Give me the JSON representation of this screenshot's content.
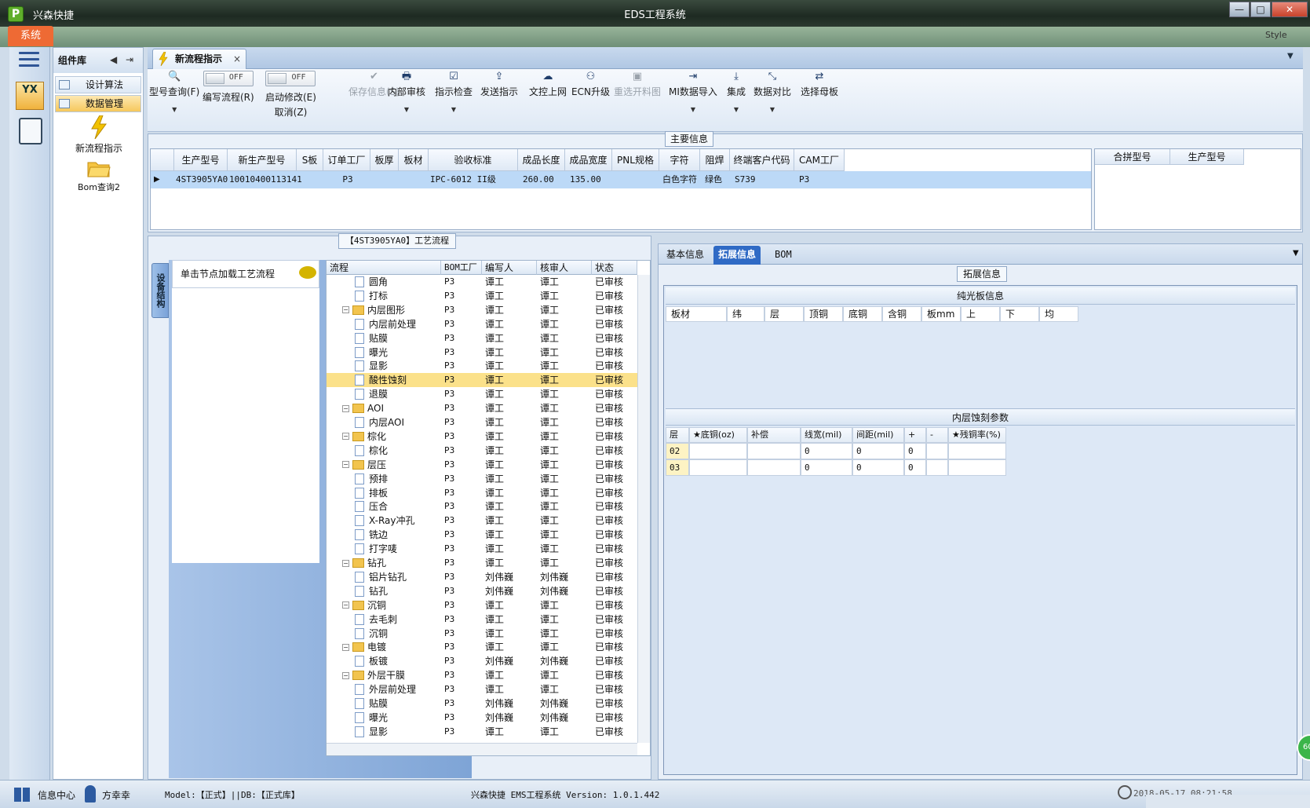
{
  "app": {
    "name": "兴森快捷",
    "window_title": "EDS工程系统",
    "icon_letter": "P"
  },
  "window_buttons": {
    "minimize": "—",
    "restore": "□",
    "close": "✕"
  },
  "menu": {
    "system": "系统",
    "style": "Style"
  },
  "component_panel": {
    "title": "组件库",
    "items": [
      {
        "label": "设计算法"
      },
      {
        "label": "数据管理"
      }
    ],
    "tiles": [
      {
        "label": "新流程指示"
      },
      {
        "label": "Bom查询2"
      }
    ]
  },
  "left_strip": {
    "logo_text": "YX"
  },
  "tab": {
    "label": "新流程指示",
    "close": "×"
  },
  "toolbar": {
    "model_query": "型号查询(F)",
    "write_flow": "编写流程(R)",
    "start_modify": "启动修改(E)",
    "cancel": "取消(Z)",
    "toggle_off": "OFF",
    "save_info": "保存信息(S)",
    "internal_review": "内部审核",
    "instruction_check": "指示检查",
    "send_instruction": "发送指示",
    "doc_upload": "文控上网",
    "ecn_upgrade": "ECN升级",
    "reselect_layout": "重选开料图",
    "mi_import": "MI数据导入",
    "integrate": "集成",
    "data_compare": "数据对比",
    "select_master": "选择母板"
  },
  "main_info": {
    "title": "主要信息",
    "columns": [
      "生产型号",
      "新生产型号",
      "S板",
      "订单工厂",
      "板厚",
      "板材",
      "验收标准",
      "成品长度",
      "成品宽度",
      "PNL规格",
      "字符",
      "阻焊",
      "终端客户代码",
      "CAM工厂"
    ],
    "row": [
      "4ST3905YA0",
      "10010400113141",
      "",
      "P3",
      "",
      "",
      "IPC-6012 II级",
      "260.00",
      "135.00",
      "",
      "白色字符",
      "绿色",
      "S739",
      "P3"
    ],
    "side_columns": [
      "合拼型号",
      "生产型号"
    ]
  },
  "process": {
    "title": "【4ST3905YA0】工艺流程",
    "vertical_tab": "设备结构",
    "load_hint": "单击节点加载工艺流程",
    "columns": [
      "流程",
      "BOM工厂",
      "编写人",
      "核审人",
      "状态"
    ],
    "rows": [
      {
        "name": "圆角",
        "level": 2,
        "type": "file",
        "factory": "P3",
        "writer": "谭工",
        "reviewer": "谭工",
        "status": "已审核"
      },
      {
        "name": "打标",
        "level": 2,
        "type": "file",
        "factory": "P3",
        "writer": "谭工",
        "reviewer": "谭工",
        "status": "已审核"
      },
      {
        "name": "内层图形",
        "level": 1,
        "type": "folder",
        "factory": "P3",
        "writer": "谭工",
        "reviewer": "谭工",
        "status": "已审核"
      },
      {
        "name": "内层前处理",
        "level": 2,
        "type": "file",
        "factory": "P3",
        "writer": "谭工",
        "reviewer": "谭工",
        "status": "已审核"
      },
      {
        "name": "贴膜",
        "level": 2,
        "type": "file",
        "factory": "P3",
        "writer": "谭工",
        "reviewer": "谭工",
        "status": "已审核"
      },
      {
        "name": "曝光",
        "level": 2,
        "type": "file",
        "factory": "P3",
        "writer": "谭工",
        "reviewer": "谭工",
        "status": "已审核"
      },
      {
        "name": "显影",
        "level": 2,
        "type": "file",
        "factory": "P3",
        "writer": "谭工",
        "reviewer": "谭工",
        "status": "已审核"
      },
      {
        "name": "酸性蚀刻",
        "level": 2,
        "type": "file",
        "factory": "P3",
        "writer": "谭工",
        "reviewer": "谭工",
        "status": "已审核",
        "selected": true
      },
      {
        "name": "退膜",
        "level": 2,
        "type": "file",
        "factory": "P3",
        "writer": "谭工",
        "reviewer": "谭工",
        "status": "已审核"
      },
      {
        "name": "AOI",
        "level": 1,
        "type": "folder",
        "factory": "P3",
        "writer": "谭工",
        "reviewer": "谭工",
        "status": "已审核"
      },
      {
        "name": "内层AOI",
        "level": 2,
        "type": "file",
        "factory": "P3",
        "writer": "谭工",
        "reviewer": "谭工",
        "status": "已审核"
      },
      {
        "name": "棕化",
        "level": 1,
        "type": "folder",
        "factory": "P3",
        "writer": "谭工",
        "reviewer": "谭工",
        "status": "已审核"
      },
      {
        "name": "棕化",
        "level": 2,
        "type": "file",
        "factory": "P3",
        "writer": "谭工",
        "reviewer": "谭工",
        "status": "已审核"
      },
      {
        "name": "层压",
        "level": 1,
        "type": "folder",
        "factory": "P3",
        "writer": "谭工",
        "reviewer": "谭工",
        "status": "已审核"
      },
      {
        "name": "预排",
        "level": 2,
        "type": "file",
        "factory": "P3",
        "writer": "谭工",
        "reviewer": "谭工",
        "status": "已审核"
      },
      {
        "name": "排板",
        "level": 2,
        "type": "file",
        "factory": "P3",
        "writer": "谭工",
        "reviewer": "谭工",
        "status": "已审核"
      },
      {
        "name": "压合",
        "level": 2,
        "type": "file",
        "factory": "P3",
        "writer": "谭工",
        "reviewer": "谭工",
        "status": "已审核"
      },
      {
        "name": "X-Ray冲孔",
        "level": 2,
        "type": "file",
        "factory": "P3",
        "writer": "谭工",
        "reviewer": "谭工",
        "status": "已审核"
      },
      {
        "name": "铣边",
        "level": 2,
        "type": "file",
        "factory": "P3",
        "writer": "谭工",
        "reviewer": "谭工",
        "status": "已审核"
      },
      {
        "name": "打字唛",
        "level": 2,
        "type": "file",
        "factory": "P3",
        "writer": "谭工",
        "reviewer": "谭工",
        "status": "已审核"
      },
      {
        "name": "钻孔",
        "level": 1,
        "type": "folder",
        "factory": "P3",
        "writer": "谭工",
        "reviewer": "谭工",
        "status": "已审核"
      },
      {
        "name": "铝片钻孔",
        "level": 2,
        "type": "file",
        "factory": "P3",
        "writer": "刘伟巍",
        "reviewer": "刘伟巍",
        "status": "已审核"
      },
      {
        "name": "钻孔",
        "level": 2,
        "type": "file",
        "factory": "P3",
        "writer": "刘伟巍",
        "reviewer": "刘伟巍",
        "status": "已审核"
      },
      {
        "name": "沉铜",
        "level": 1,
        "type": "folder",
        "factory": "P3",
        "writer": "谭工",
        "reviewer": "谭工",
        "status": "已审核"
      },
      {
        "name": "去毛刺",
        "level": 2,
        "type": "file",
        "factory": "P3",
        "writer": "谭工",
        "reviewer": "谭工",
        "status": "已审核"
      },
      {
        "name": "沉铜",
        "level": 2,
        "type": "file",
        "factory": "P3",
        "writer": "谭工",
        "reviewer": "谭工",
        "status": "已审核"
      },
      {
        "name": "电镀",
        "level": 1,
        "type": "folder",
        "factory": "P3",
        "writer": "谭工",
        "reviewer": "谭工",
        "status": "已审核"
      },
      {
        "name": "板镀",
        "level": 2,
        "type": "file",
        "factory": "P3",
        "writer": "刘伟巍",
        "reviewer": "刘伟巍",
        "status": "已审核"
      },
      {
        "name": "外层干膜",
        "level": 1,
        "type": "folder",
        "factory": "P3",
        "writer": "谭工",
        "reviewer": "谭工",
        "status": "已审核"
      },
      {
        "name": "外层前处理",
        "level": 2,
        "type": "file",
        "factory": "P3",
        "writer": "谭工",
        "reviewer": "谭工",
        "status": "已审核"
      },
      {
        "name": "贴膜",
        "level": 2,
        "type": "file",
        "factory": "P3",
        "writer": "刘伟巍",
        "reviewer": "刘伟巍",
        "status": "已审核"
      },
      {
        "name": "曝光",
        "level": 2,
        "type": "file",
        "factory": "P3",
        "writer": "刘伟巍",
        "reviewer": "刘伟巍",
        "status": "已审核"
      },
      {
        "name": "显影",
        "level": 2,
        "type": "file",
        "factory": "P3",
        "writer": "谭工",
        "reviewer": "谭工",
        "status": "已审核"
      }
    ]
  },
  "right_panel": {
    "tabs": [
      "基本信息",
      "拓展信息",
      "BOM"
    ],
    "ext_title": "拓展信息",
    "plain_title": "纯光板信息",
    "plain_columns": [
      "板材",
      "纬",
      "层",
      "顶铜",
      "底铜",
      "含铜",
      "板mm",
      "上",
      "下",
      "均"
    ],
    "etch_title": "内层蚀刻参数",
    "etch_columns": [
      "层",
      "★底铜(oz)",
      "补偿",
      "线宽(mil)",
      "间距(mil)",
      "+",
      "-",
      "★残铜率(%)"
    ],
    "etch_rows": [
      [
        "02",
        "",
        "",
        "0",
        "0",
        "0",
        "",
        ""
      ],
      [
        "03",
        "",
        "",
        "0",
        "0",
        "0",
        "",
        ""
      ]
    ]
  },
  "status_bar": {
    "info_center": "信息中心",
    "user": "方幸幸",
    "model": "Model:【正式】||DB:【正式库】",
    "version": "兴森快捷 EMS工程系统 Version: 1.0.1.442",
    "datetime": "2018-05-17 08:21:58"
  },
  "misc": {
    "badge": "60"
  }
}
